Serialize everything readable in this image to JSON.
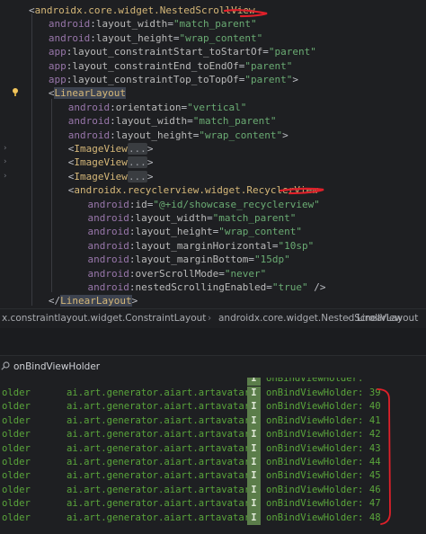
{
  "editor": {
    "lines": [
      {
        "indent": 0,
        "parts": [
          [
            "punct",
            "<"
          ],
          [
            "tag",
            "androidx.core.widget.NestedScrollView"
          ]
        ]
      },
      {
        "indent": 2,
        "parts": [
          [
            "ns",
            "android"
          ],
          [
            "punct",
            ":"
          ],
          [
            "attr",
            "layout_width"
          ],
          [
            "punct",
            "="
          ],
          [
            "val",
            "\"match_parent\""
          ]
        ]
      },
      {
        "indent": 2,
        "parts": [
          [
            "ns",
            "android"
          ],
          [
            "punct",
            ":"
          ],
          [
            "attr",
            "layout_height"
          ],
          [
            "punct",
            "="
          ],
          [
            "val",
            "\"wrap_content\""
          ]
        ]
      },
      {
        "indent": 2,
        "parts": [
          [
            "ns",
            "app"
          ],
          [
            "punct",
            ":"
          ],
          [
            "attr",
            "layout_constraintStart_toStartOf"
          ],
          [
            "punct",
            "="
          ],
          [
            "val",
            "\"parent\""
          ]
        ]
      },
      {
        "indent": 2,
        "parts": [
          [
            "ns",
            "app"
          ],
          [
            "punct",
            ":"
          ],
          [
            "attr",
            "layout_constraintEnd_toEndOf"
          ],
          [
            "punct",
            "="
          ],
          [
            "val",
            "\"parent\""
          ]
        ]
      },
      {
        "indent": 2,
        "parts": [
          [
            "ns",
            "app"
          ],
          [
            "punct",
            ":"
          ],
          [
            "attr",
            "layout_constraintTop_toTopOf"
          ],
          [
            "punct",
            "="
          ],
          [
            "val",
            "\"parent\""
          ],
          [
            "punct",
            ">"
          ]
        ]
      },
      {
        "indent": 2,
        "parts": [
          [
            "punct",
            "<"
          ],
          [
            "tag",
            "LinearLayout"
          ]
        ],
        "highlight": true,
        "bulb": true
      },
      {
        "indent": 4,
        "parts": [
          [
            "ns",
            "android"
          ],
          [
            "punct",
            ":"
          ],
          [
            "attr",
            "orientation"
          ],
          [
            "punct",
            "="
          ],
          [
            "val",
            "\"vertical\""
          ]
        ]
      },
      {
        "indent": 4,
        "parts": [
          [
            "ns",
            "android"
          ],
          [
            "punct",
            ":"
          ],
          [
            "attr",
            "layout_width"
          ],
          [
            "punct",
            "="
          ],
          [
            "val",
            "\"match_parent\""
          ]
        ]
      },
      {
        "indent": 4,
        "parts": [
          [
            "ns",
            "android"
          ],
          [
            "punct",
            ":"
          ],
          [
            "attr",
            "layout_height"
          ],
          [
            "punct",
            "="
          ],
          [
            "val",
            "\"wrap_content\""
          ],
          [
            "punct",
            ">"
          ]
        ]
      },
      {
        "indent": 4,
        "parts": [
          [
            "punct",
            "<"
          ],
          [
            "tag",
            "ImageView"
          ],
          [
            "fold",
            "..."
          ],
          [
            "punct",
            ">"
          ]
        ],
        "fold": true
      },
      {
        "indent": 4,
        "parts": [
          [
            "punct",
            "<"
          ],
          [
            "tag",
            "ImageView"
          ],
          [
            "fold",
            "..."
          ],
          [
            "punct",
            ">"
          ]
        ],
        "fold": true
      },
      {
        "indent": 4,
        "parts": [
          [
            "punct",
            "<"
          ],
          [
            "tag",
            "ImageView"
          ],
          [
            "fold",
            "..."
          ],
          [
            "punct",
            ">"
          ]
        ],
        "fold": true
      },
      {
        "indent": 4,
        "parts": [
          [
            "punct",
            "<"
          ],
          [
            "tag",
            "androidx.recyclerview.widget.RecyclerView"
          ]
        ]
      },
      {
        "indent": 6,
        "parts": [
          [
            "ns",
            "android"
          ],
          [
            "punct",
            ":"
          ],
          [
            "attr",
            "id"
          ],
          [
            "punct",
            "="
          ],
          [
            "val",
            "\"@+id/showcase_recyclerview\""
          ]
        ]
      },
      {
        "indent": 6,
        "parts": [
          [
            "ns",
            "android"
          ],
          [
            "punct",
            ":"
          ],
          [
            "attr",
            "layout_width"
          ],
          [
            "punct",
            "="
          ],
          [
            "val",
            "\"match_parent\""
          ]
        ]
      },
      {
        "indent": 6,
        "parts": [
          [
            "ns",
            "android"
          ],
          [
            "punct",
            ":"
          ],
          [
            "attr",
            "layout_height"
          ],
          [
            "punct",
            "="
          ],
          [
            "val",
            "\"wrap_content\""
          ]
        ]
      },
      {
        "indent": 6,
        "parts": [
          [
            "ns",
            "android"
          ],
          [
            "punct",
            ":"
          ],
          [
            "attr",
            "layout_marginHorizontal"
          ],
          [
            "punct",
            "="
          ],
          [
            "val",
            "\"10sp\""
          ]
        ]
      },
      {
        "indent": 6,
        "parts": [
          [
            "ns",
            "android"
          ],
          [
            "punct",
            ":"
          ],
          [
            "attr",
            "layout_marginBottom"
          ],
          [
            "punct",
            "="
          ],
          [
            "val",
            "\"15dp\""
          ]
        ]
      },
      {
        "indent": 6,
        "parts": [
          [
            "ns",
            "android"
          ],
          [
            "punct",
            ":"
          ],
          [
            "attr",
            "overScrollMode"
          ],
          [
            "punct",
            "="
          ],
          [
            "val",
            "\"never\""
          ]
        ]
      },
      {
        "indent": 6,
        "parts": [
          [
            "ns",
            "android"
          ],
          [
            "punct",
            ":"
          ],
          [
            "attr",
            "nestedScrollingEnabled"
          ],
          [
            "punct",
            "="
          ],
          [
            "val",
            "\"true\""
          ],
          [
            "punct",
            " />"
          ]
        ]
      },
      {
        "indent": 2,
        "parts": [
          [
            "punct",
            "</"
          ],
          [
            "tag",
            "LinearLayout"
          ],
          [
            "punct",
            ">"
          ]
        ],
        "highlight": true
      }
    ]
  },
  "breadcrumb": {
    "items": [
      "x.constraintlayout.widget.ConstraintLayout",
      "androidx.core.widget.NestedScrollView",
      "LinearLayout"
    ]
  },
  "logcat": {
    "filter_query": "onBindViewHolder",
    "tag": "older",
    "package": "ai.art.generator.aiart.artavatar",
    "level": "I",
    "message_prefix": "onBindViewHolder: ",
    "positions": [
      "39",
      "40",
      "41",
      "42",
      "43",
      "44",
      "45",
      "46",
      "47",
      "48"
    ]
  },
  "colors": {
    "annotation": "#e0202a"
  }
}
